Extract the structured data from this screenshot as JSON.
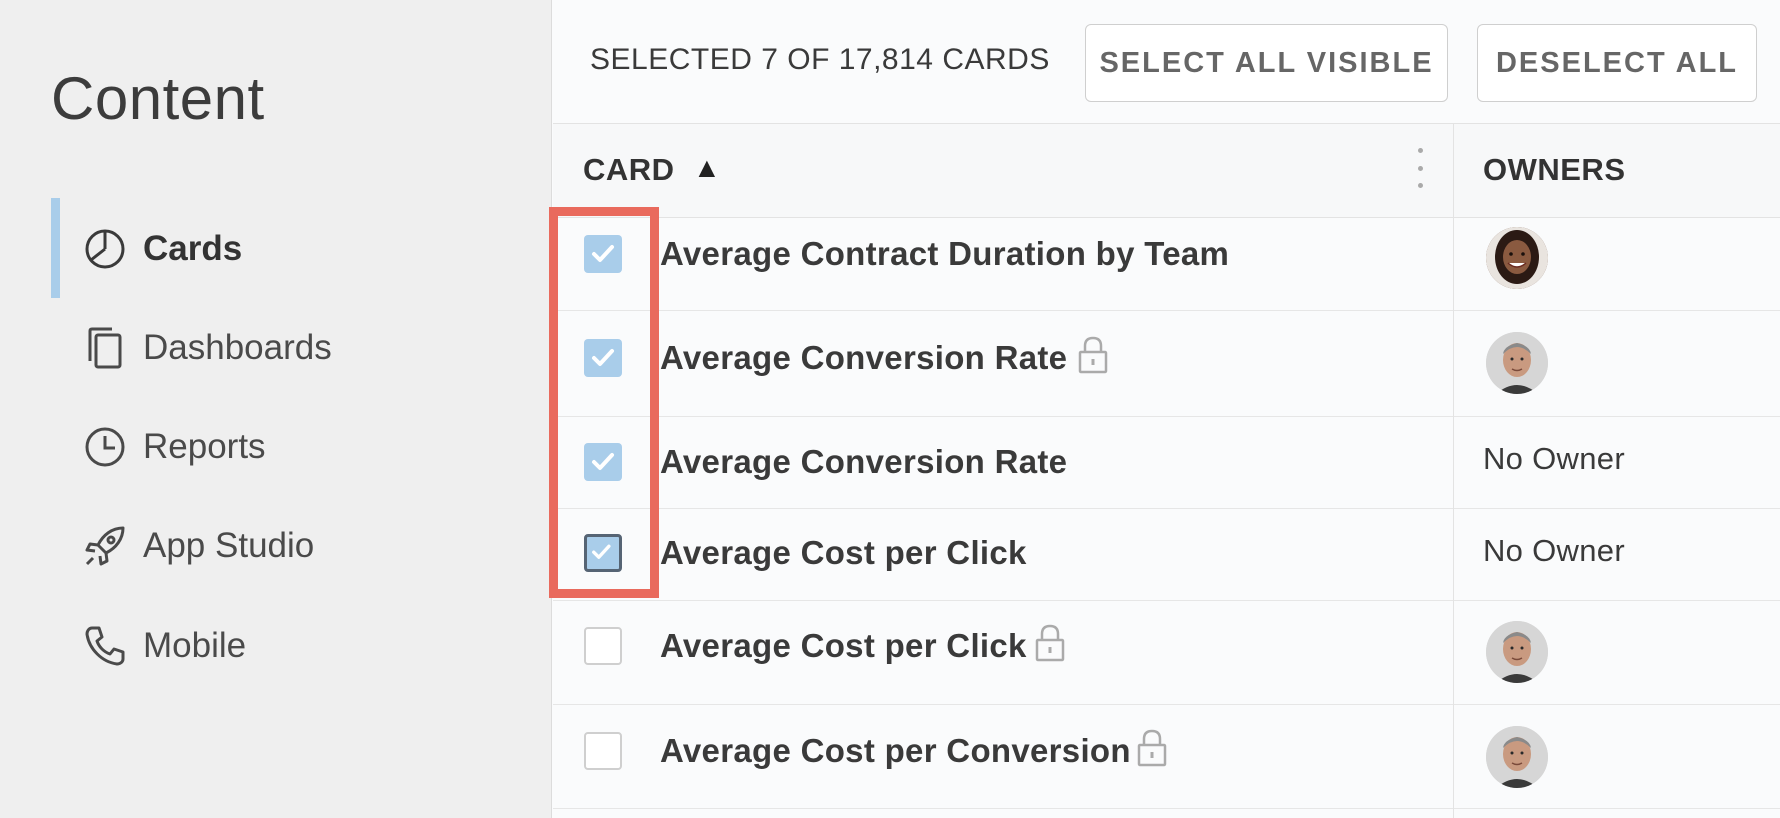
{
  "sidebar": {
    "title": "Content",
    "items": [
      {
        "label": "Cards",
        "icon": "pie-chart-icon",
        "active": true
      },
      {
        "label": "Dashboards",
        "icon": "copy-pages-icon",
        "active": false
      },
      {
        "label": "Reports",
        "icon": "clock-icon",
        "active": false
      },
      {
        "label": "App Studio",
        "icon": "rocket-icon",
        "active": false
      },
      {
        "label": "Mobile",
        "icon": "phone-icon",
        "active": false
      }
    ]
  },
  "toolbar": {
    "selected_text": "SELECTED 7 OF 17,814 CARDS",
    "select_all_label": "SELECT ALL VISIBLE",
    "deselect_all_label": "DESELECT ALL"
  },
  "table": {
    "columns": {
      "card": "CARD",
      "sort_indicator": "▲",
      "owners": "OWNERS"
    },
    "rows": [
      {
        "name": "Average Contract Duration by Team",
        "checked": true,
        "locked": false,
        "owner": "avatar-woman",
        "owner_text": ""
      },
      {
        "name": "Average Conversion Rate",
        "checked": true,
        "locked": true,
        "owner": "avatar-man",
        "owner_text": ""
      },
      {
        "name": "Average Conversion Rate",
        "checked": true,
        "locked": false,
        "owner": "none",
        "owner_text": "No Owner"
      },
      {
        "name": "Average Cost per Click",
        "checked": true,
        "locked": false,
        "owner": "none",
        "owner_text": "No Owner",
        "focused": true
      },
      {
        "name": "Average Cost per Click",
        "checked": false,
        "locked": true,
        "owner": "avatar-man",
        "owner_text": ""
      },
      {
        "name": "Average Cost per Conversion",
        "checked": false,
        "locked": true,
        "owner": "avatar-man",
        "owner_text": ""
      }
    ]
  },
  "colors": {
    "accent": "#a9cdea",
    "highlight": "#e96a5d",
    "sidebar_bg": "#efefef"
  }
}
